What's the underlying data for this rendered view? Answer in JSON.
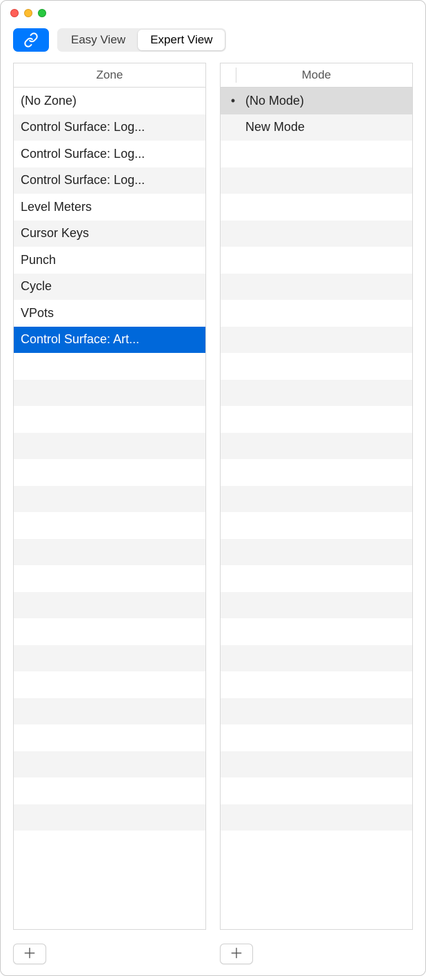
{
  "toolbar": {
    "tabs": [
      "Easy View",
      "Expert View"
    ],
    "active_tab_index": 1
  },
  "columns": {
    "zone": {
      "header": "Zone",
      "selected_index": 9,
      "items": [
        "(No Zone)",
        "Control Surface: Log...",
        "Control Surface: Log...",
        "Control Surface: Log...",
        "Level Meters",
        "Cursor Keys",
        "Punch",
        "Cycle",
        "VPots",
        "Control Surface: Art..."
      ]
    },
    "mode": {
      "header": "Mode",
      "selected_index": 0,
      "items": [
        {
          "label": "(No Mode)",
          "bullet": true
        },
        {
          "label": "New Mode",
          "bullet": false
        }
      ]
    }
  }
}
